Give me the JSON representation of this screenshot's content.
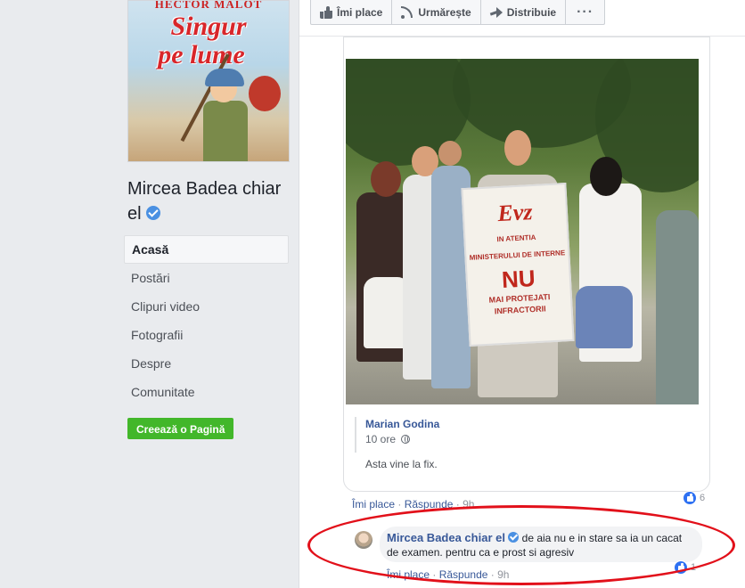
{
  "left": {
    "cover": {
      "author": "HECTOR MALOT",
      "title_line1": "Singur",
      "title_line2": "pe lume"
    },
    "page_name": "Mircea Badea chiar el",
    "nav": [
      {
        "label": "Acasă",
        "active": true
      },
      {
        "label": "Postări"
      },
      {
        "label": "Clipuri video"
      },
      {
        "label": "Fotografii"
      },
      {
        "label": "Despre"
      },
      {
        "label": "Comunitate"
      }
    ],
    "create_page": "Creează o Pagină"
  },
  "actionbar": {
    "like": "Îmi place",
    "follow": "Urmărește",
    "share": "Distribuie",
    "more": "···"
  },
  "post": {
    "sign": {
      "brand": "Evz",
      "line1": "IN ATENTIA",
      "line2": "MINISTERULUI DE INTERNE",
      "big": "NU",
      "line3": "MAI PROTEJATI",
      "line4": "INFRACTORII"
    },
    "quote_author": "Marian Godina",
    "quote_time": "10 ore",
    "quote_text": "Asta vine la fix.",
    "meta": {
      "like": "Îmi place",
      "reply": "Răspunde",
      "time": "9h"
    },
    "reaction_count": "6"
  },
  "comment": {
    "author": "Mircea Badea chiar el",
    "text": "de aia nu e in stare sa ia un cacat de examen. pentru ca e prost si agresiv",
    "meta": {
      "like": "Îmi place",
      "reply": "Răspunde",
      "time": "9h"
    },
    "reaction_count": "1"
  },
  "colors": {
    "link": "#385898",
    "green": "#42b72a",
    "highlight": "#e2101a",
    "like_blue": "#2e71f2"
  }
}
